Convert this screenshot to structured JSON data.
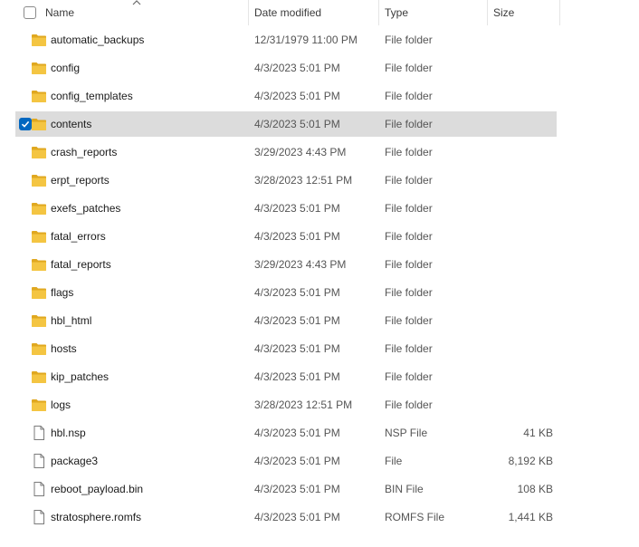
{
  "columns": {
    "name": "Name",
    "date": "Date modified",
    "type": "Type",
    "size": "Size"
  },
  "icons": {
    "folder": "folder-icon",
    "file": "file-icon",
    "checkbox": "checkbox-icon",
    "sort": "sort-ascending-icon"
  },
  "colors": {
    "folder": "#f4c542",
    "selection": "#dcdcdc",
    "accent": "#0067c0"
  },
  "files": [
    {
      "name": "automatic_backups",
      "date": "12/31/1979 11:00 PM",
      "type": "File folder",
      "size": "",
      "kind": "folder",
      "selected": false
    },
    {
      "name": "config",
      "date": "4/3/2023 5:01 PM",
      "type": "File folder",
      "size": "",
      "kind": "folder",
      "selected": false
    },
    {
      "name": "config_templates",
      "date": "4/3/2023 5:01 PM",
      "type": "File folder",
      "size": "",
      "kind": "folder",
      "selected": false
    },
    {
      "name": "contents",
      "date": "4/3/2023 5:01 PM",
      "type": "File folder",
      "size": "",
      "kind": "folder",
      "selected": true
    },
    {
      "name": "crash_reports",
      "date": "3/29/2023 4:43 PM",
      "type": "File folder",
      "size": "",
      "kind": "folder",
      "selected": false
    },
    {
      "name": "erpt_reports",
      "date": "3/28/2023 12:51 PM",
      "type": "File folder",
      "size": "",
      "kind": "folder",
      "selected": false
    },
    {
      "name": "exefs_patches",
      "date": "4/3/2023 5:01 PM",
      "type": "File folder",
      "size": "",
      "kind": "folder",
      "selected": false
    },
    {
      "name": "fatal_errors",
      "date": "4/3/2023 5:01 PM",
      "type": "File folder",
      "size": "",
      "kind": "folder",
      "selected": false
    },
    {
      "name": "fatal_reports",
      "date": "3/29/2023 4:43 PM",
      "type": "File folder",
      "size": "",
      "kind": "folder",
      "selected": false
    },
    {
      "name": "flags",
      "date": "4/3/2023 5:01 PM",
      "type": "File folder",
      "size": "",
      "kind": "folder",
      "selected": false
    },
    {
      "name": "hbl_html",
      "date": "4/3/2023 5:01 PM",
      "type": "File folder",
      "size": "",
      "kind": "folder",
      "selected": false
    },
    {
      "name": "hosts",
      "date": "4/3/2023 5:01 PM",
      "type": "File folder",
      "size": "",
      "kind": "folder",
      "selected": false
    },
    {
      "name": "kip_patches",
      "date": "4/3/2023 5:01 PM",
      "type": "File folder",
      "size": "",
      "kind": "folder",
      "selected": false
    },
    {
      "name": "logs",
      "date": "3/28/2023 12:51 PM",
      "type": "File folder",
      "size": "",
      "kind": "folder",
      "selected": false
    },
    {
      "name": "hbl.nsp",
      "date": "4/3/2023 5:01 PM",
      "type": "NSP File",
      "size": "41 KB",
      "kind": "file",
      "selected": false
    },
    {
      "name": "package3",
      "date": "4/3/2023 5:01 PM",
      "type": "File",
      "size": "8,192 KB",
      "kind": "file",
      "selected": false
    },
    {
      "name": "reboot_payload.bin",
      "date": "4/3/2023 5:01 PM",
      "type": "BIN File",
      "size": "108 KB",
      "kind": "file",
      "selected": false
    },
    {
      "name": "stratosphere.romfs",
      "date": "4/3/2023 5:01 PM",
      "type": "ROMFS File",
      "size": "1,441 KB",
      "kind": "file",
      "selected": false
    }
  ]
}
